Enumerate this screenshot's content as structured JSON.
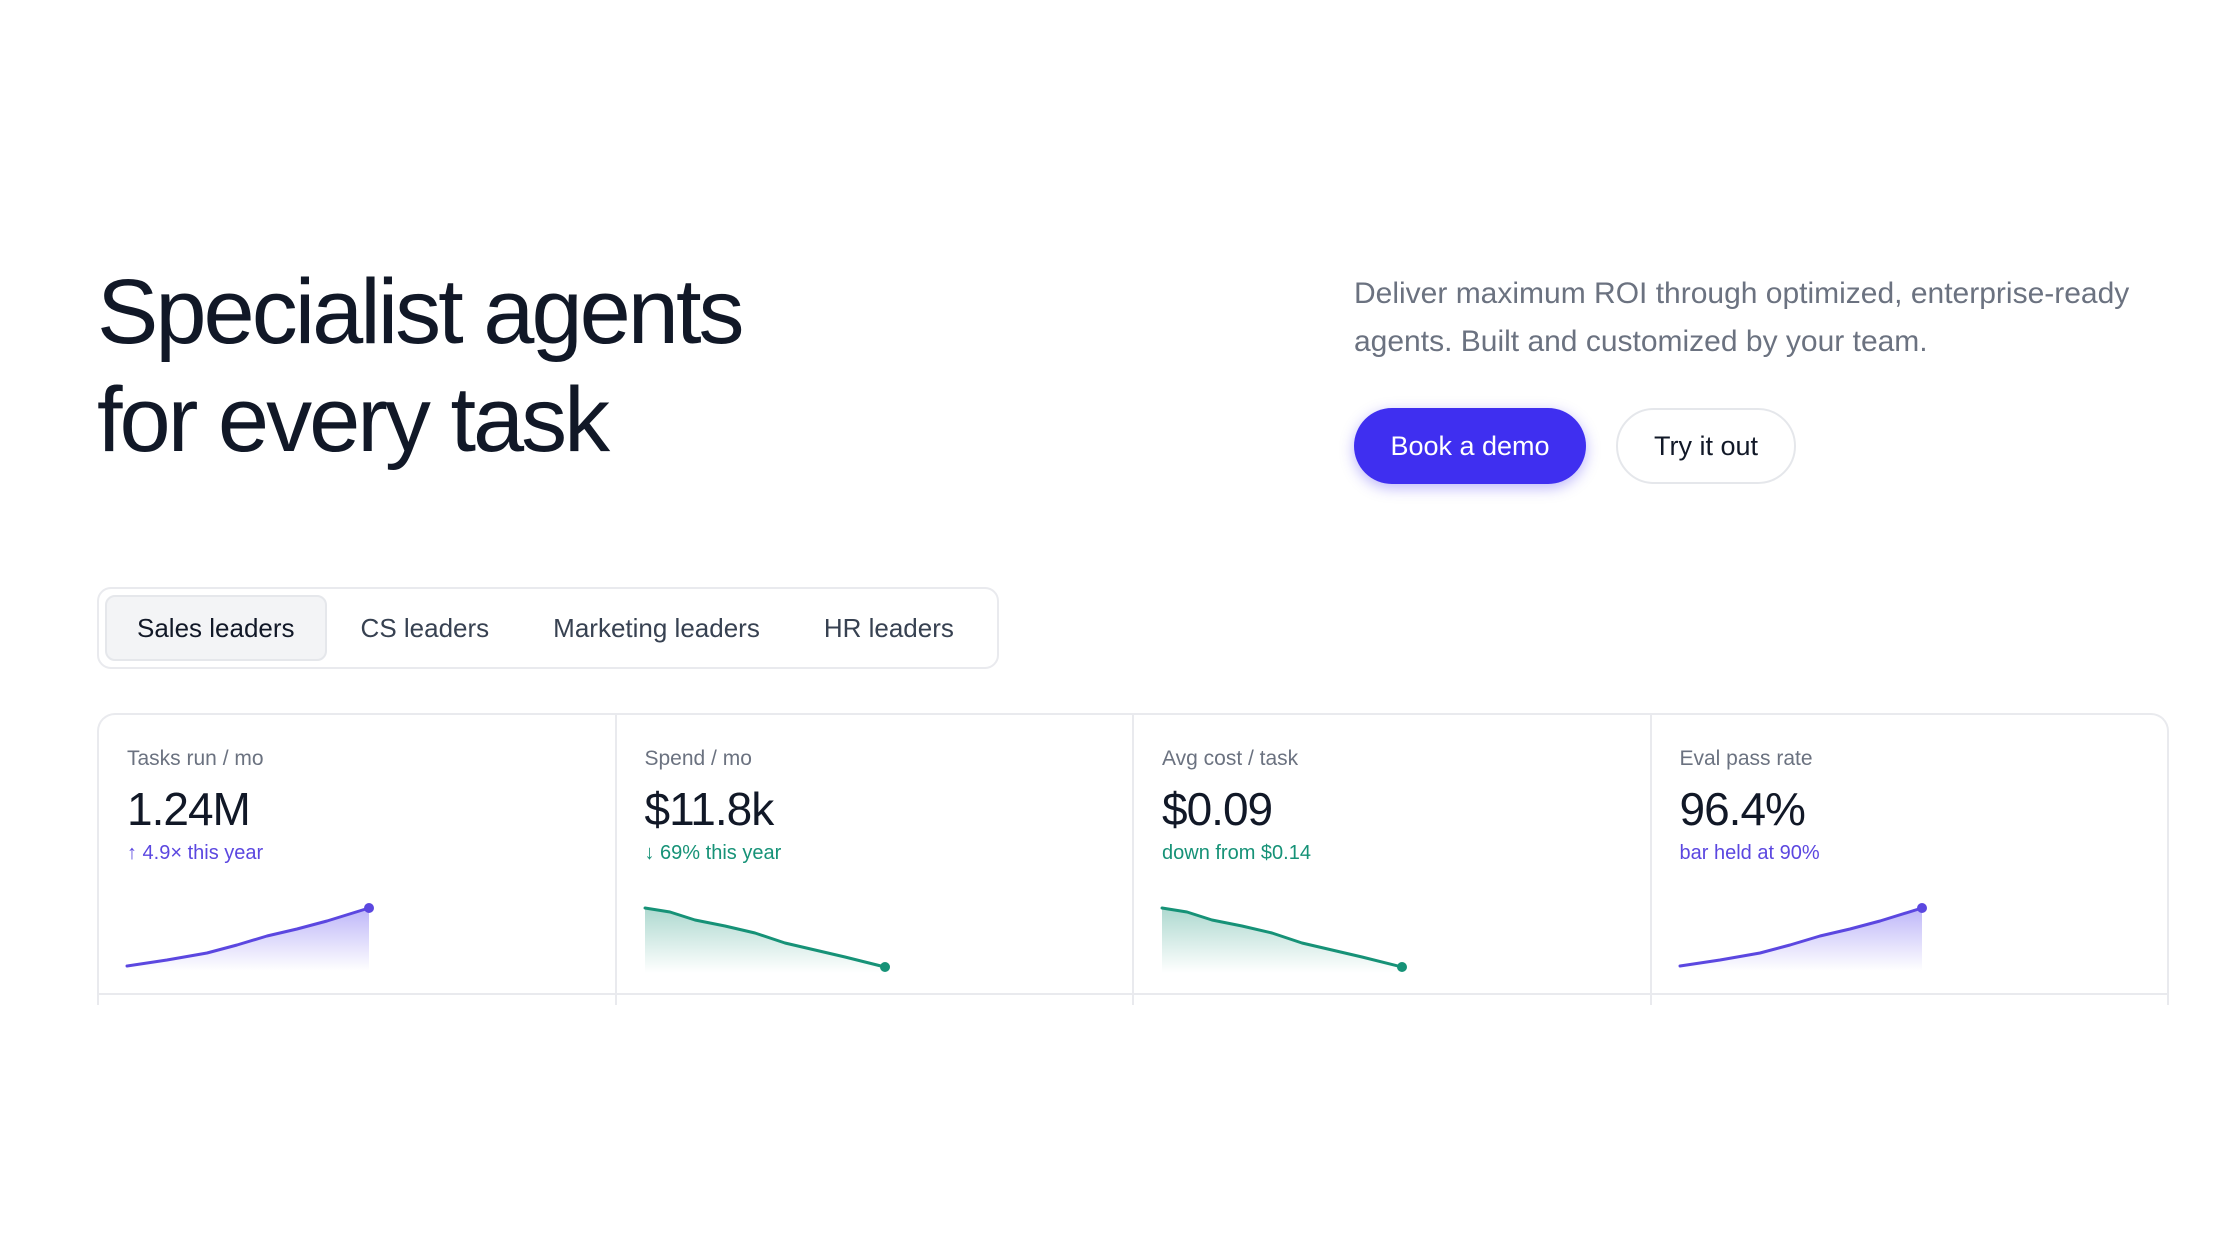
{
  "hero": {
    "title_line1": "Specialist agents",
    "title_line2": "for every task",
    "subtitle": "Deliver maximum ROI through optimized, enterprise-ready agents. Built and customized by your team.",
    "primary_cta": "Book a demo",
    "secondary_cta": "Try it out"
  },
  "tabs": [
    {
      "label": "Sales leaders",
      "active": true
    },
    {
      "label": "CS leaders",
      "active": false
    },
    {
      "label": "Marketing leaders",
      "active": false
    },
    {
      "label": "HR leaders",
      "active": false
    }
  ],
  "metrics": [
    {
      "label": "Tasks run / mo",
      "value": "1.24M",
      "delta": "↑ 4.9× this year",
      "trend": "up",
      "color": "#5b47e0"
    },
    {
      "label": "Spend / mo",
      "value": "$11.8k",
      "delta": "↓ 69% this year",
      "trend": "down",
      "color": "#169277"
    },
    {
      "label": "Avg cost / task",
      "value": "$0.09",
      "delta": "down from $0.14",
      "trend": "down",
      "color": "#169277"
    },
    {
      "label": "Eval pass rate",
      "value": "96.4%",
      "delta": "bar held at 90%",
      "trend": "up",
      "color": "#5b47e0"
    }
  ],
  "colors": {
    "accent": "#3f2ff0",
    "positive_purple": "#5b47e0",
    "positive_green": "#169277"
  }
}
